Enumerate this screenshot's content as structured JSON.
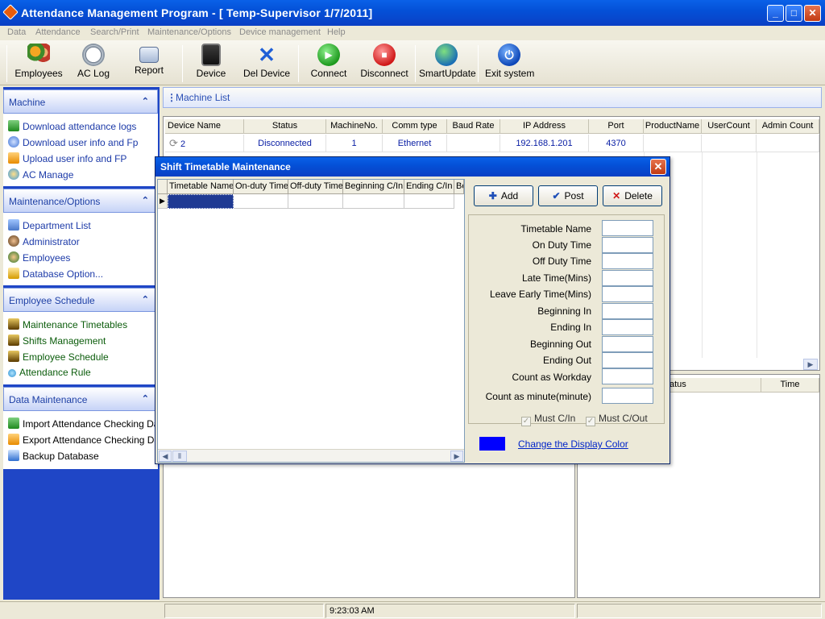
{
  "window": {
    "title": "Attendance Management Program - [ Temp-Supervisor 1/7/2011]"
  },
  "menu": [
    "Data",
    "Attendance",
    "Search/Print",
    "Maintenance/Options",
    "Device management",
    "Help"
  ],
  "toolbar": {
    "employees": "Employees",
    "aclog": "AC Log",
    "report": "Report",
    "device": "Device",
    "deldevice": "Del Device",
    "connect": "Connect",
    "disconnect": "Disconnect",
    "smartupdate": "SmartUpdate",
    "exit": "Exit system"
  },
  "sidebar": {
    "machine": {
      "title": "Machine",
      "items": [
        "Download attendance logs",
        "Download user info and Fp",
        "Upload user info and FP",
        "AC Manage"
      ]
    },
    "maintenance": {
      "title": "Maintenance/Options",
      "items": [
        "Department List",
        "Administrator",
        "Employees",
        "Database Option..."
      ]
    },
    "schedule": {
      "title": "Employee Schedule",
      "items": [
        "Maintenance Timetables",
        "Shifts Management",
        "Employee Schedule",
        "Attendance Rule"
      ]
    },
    "datamaint": {
      "title": "Data Maintenance",
      "items": [
        "Import Attendance Checking Data",
        "Export Attendance Checking Data",
        "Backup Database"
      ]
    }
  },
  "machinelist": {
    "title": "Machine List",
    "columns": [
      "Device Name",
      "Status",
      "MachineNo.",
      "Comm type",
      "Baud Rate",
      "IP Address",
      "Port",
      "ProductName",
      "UserCount",
      "Admin Count"
    ],
    "rows": [
      {
        "device_name": "2",
        "status": "Disconnected",
        "machine_no": "1",
        "comm_type": "Ethernet",
        "baud_rate": "",
        "ip": "192.168.1.201",
        "port": "4370"
      }
    ]
  },
  "lowerright": {
    "col_status": "atus",
    "col_time": "Time"
  },
  "statusbar": {
    "time": "9:23:03 AM"
  },
  "dialog": {
    "title": "Shift Timetable Maintenance",
    "columns": [
      "Timetable Name",
      "On-duty Time",
      "Off-duty Time",
      "Beginning C/In",
      "Ending C/In",
      "Be"
    ],
    "buttons": {
      "add": "Add",
      "post": "Post",
      "delete": "Delete"
    },
    "fields": [
      "Timetable Name",
      "On Duty Time",
      "Off Duty Time",
      "Late Time(Mins)",
      "Leave Early Time(Mins)",
      "Beginning In",
      "Ending In",
      "Beginning Out",
      "Ending Out",
      "Count as Workday",
      "Count as minute(minute)"
    ],
    "checkboxes": {
      "must_cin": "Must C/In",
      "must_cout": "Must C/Out"
    },
    "color_link": "Change the Display Color",
    "display_color": "#0000ff"
  }
}
